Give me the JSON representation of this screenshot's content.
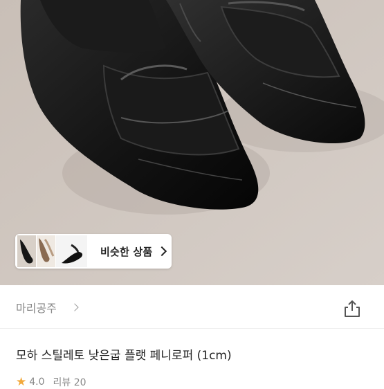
{
  "product_image": {
    "alt": "black loafers photo"
  },
  "similar": {
    "label": "비슷한 상품"
  },
  "seller": {
    "name": "마리공주"
  },
  "product": {
    "title": "모하 스틸레토 낮은굽 플랫 페니로퍼 (1cm)",
    "rating": "4.0",
    "review_label": "리뷰 20"
  },
  "colors": {
    "star": "#f2a93b",
    "background_photo": "#cdc4bd"
  },
  "icons": {
    "share": "share-icon",
    "chevron": "chevron-right-icon",
    "star": "star-icon"
  }
}
